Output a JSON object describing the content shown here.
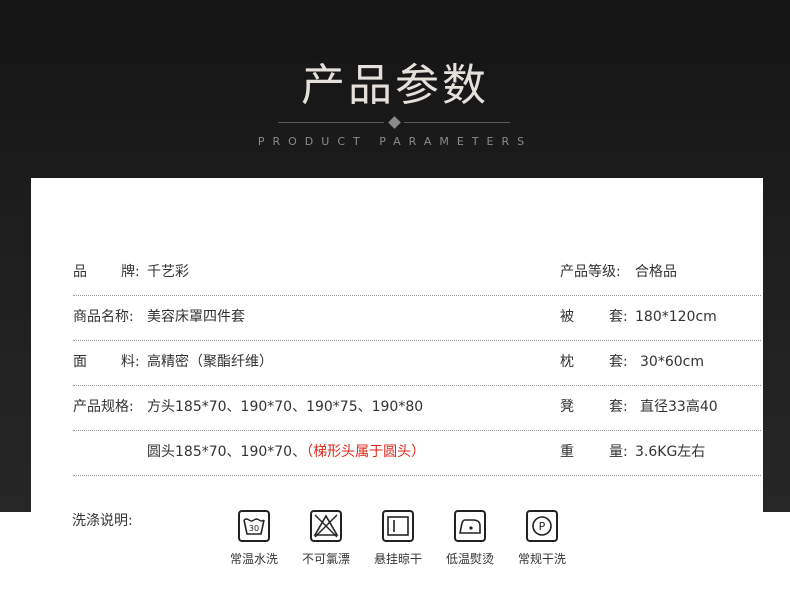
{
  "header": {
    "title": "产品参数",
    "subtitle": "PRODUCT PARAMETERS"
  },
  "rows": [
    {
      "left_label_a": "品",
      "left_label_b": "牌:",
      "left_value": "千艺彩",
      "right_label": "产品等级:",
      "right_value": "合格品"
    },
    {
      "left_label": "商品名称:",
      "left_value": "美容床罩四件套",
      "right_label_a": "被",
      "right_label_b": "套:",
      "right_value": "180*120cm"
    },
    {
      "left_label_a": "面",
      "left_label_b": "料:",
      "left_value": "高精密（聚酯纤维）",
      "right_label_a": "枕",
      "right_label_b": "套:",
      "right_value": "30*60cm"
    },
    {
      "left_label": "产品规格:",
      "left_value": "方头185*70、190*70、190*75、190*80",
      "right_label_a": "凳",
      "right_label_b": "套:",
      "right_value": "直径33高40"
    },
    {
      "left_value": "圆头185*70、190*70、",
      "left_value_red": "（梯形头属于圆头）",
      "right_label_a": "重",
      "right_label_b": "量:",
      "right_value": "3.6KG左右"
    }
  ],
  "washing": {
    "label": "洗涤说明:",
    "items": [
      {
        "icon": "wash-30-icon",
        "text": "30",
        "caption": "常温水洗"
      },
      {
        "icon": "no-bleach-icon",
        "caption": "不可氯漂"
      },
      {
        "icon": "hang-dry-icon",
        "caption": "悬挂晾干"
      },
      {
        "icon": "low-iron-icon",
        "caption": "低温熨烫"
      },
      {
        "icon": "dry-clean-icon",
        "text": "P",
        "caption": "常规干洗"
      }
    ]
  }
}
